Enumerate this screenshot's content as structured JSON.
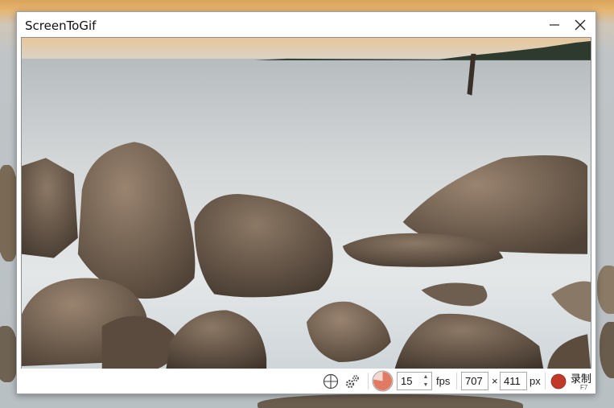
{
  "window": {
    "title": "ScreenToGif"
  },
  "titlebar": {
    "minimize_icon": "minimize-icon",
    "close_icon": "close-icon"
  },
  "toolbar": {
    "snap_icon": "crosshair-icon",
    "options_icon": "gears-icon",
    "frequency_icon": "fps-pie-icon",
    "fps_value": "15",
    "fps_unit": "fps",
    "width_value": "707",
    "times": "×",
    "height_value": "411",
    "size_unit": "px",
    "record_label": "录制",
    "record_shortcut": "F7",
    "record_color": "#c0392b",
    "frequency_color": "#e07a65"
  }
}
